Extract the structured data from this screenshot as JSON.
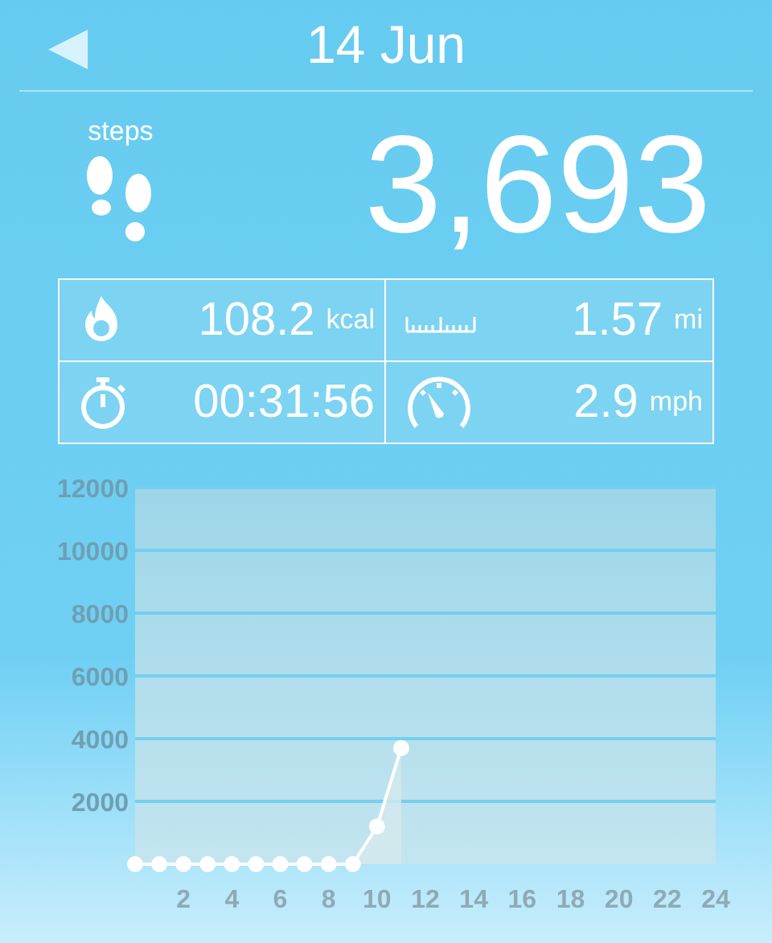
{
  "header": {
    "back": "◀",
    "title": "14 Jun"
  },
  "steps": {
    "label": "steps",
    "value": "3,693"
  },
  "stats": [
    {
      "kind": "calories",
      "value": "108.2",
      "unit": "kcal"
    },
    {
      "kind": "distance",
      "value": "1.57",
      "unit": "mi"
    },
    {
      "kind": "duration",
      "value": "00:31:56"
    },
    {
      "kind": "speed",
      "value": "2.9",
      "unit": "mph"
    }
  ],
  "chart": {
    "chart_data": {
      "type": "area",
      "x": [
        0,
        1,
        2,
        3,
        4,
        5,
        6,
        7,
        8,
        9,
        10,
        11
      ],
      "series": [
        {
          "color": "#ffffff",
          "values": [
            0,
            0,
            0,
            0,
            0,
            0,
            0,
            0,
            0,
            0,
            1200,
            3700
          ]
        }
      ],
      "grid": true,
      "xlim": [
        0,
        24
      ],
      "ylim": [
        0,
        12000
      ],
      "xticks": [
        2,
        4,
        6,
        8,
        10,
        12,
        14,
        16,
        18,
        20,
        22,
        24
      ],
      "yticks": [
        2000,
        4000,
        6000,
        8000,
        10000,
        12000
      ]
    }
  }
}
